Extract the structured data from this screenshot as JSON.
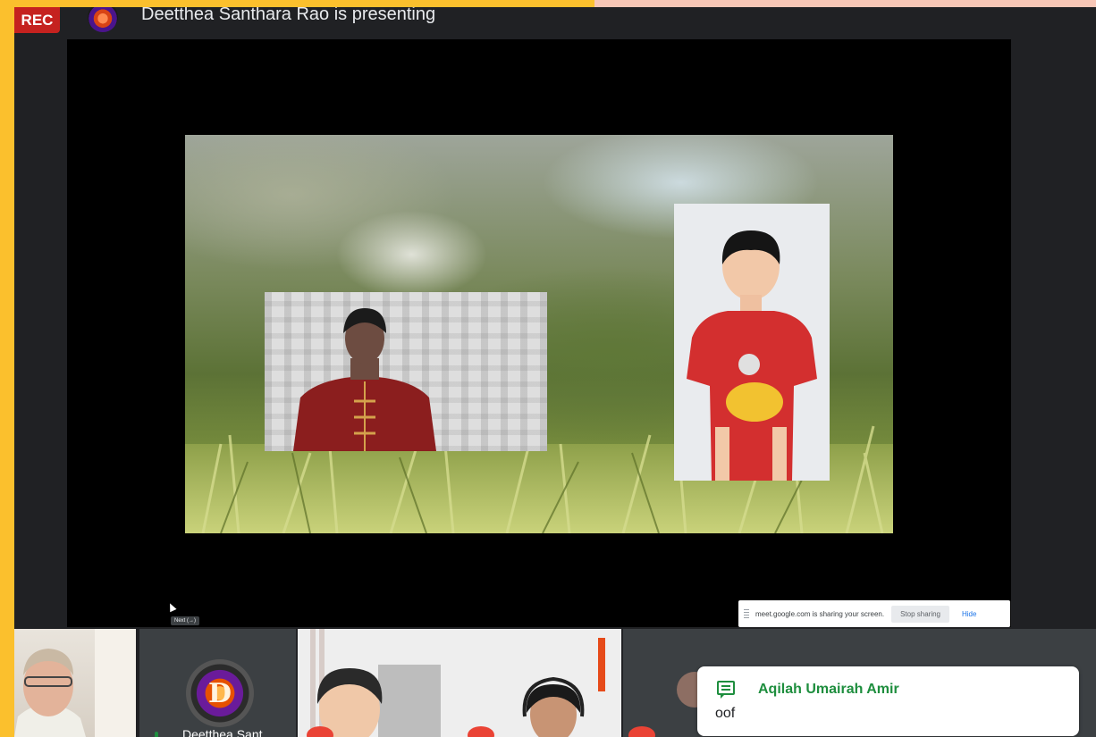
{
  "recording_badge": "REC",
  "presenter": {
    "text": "Deetthea Santhara Rao is presenting",
    "avatar_letter": "D"
  },
  "screen_share": {
    "bar_message": "meet.google.com is sharing your screen.",
    "stop_label": "Stop sharing",
    "hide_label": "Hide",
    "cursor_tooltip": "Next (→)"
  },
  "participants": [
    {
      "id": "tile1",
      "type": "video"
    },
    {
      "id": "tile2",
      "type": "avatar",
      "avatar_letter": "D",
      "name_fragment": "Deetthea Sant"
    },
    {
      "id": "tile3",
      "type": "video"
    },
    {
      "id": "tile4",
      "type": "avatar"
    }
  ],
  "chat_toast": {
    "sender": "Aqilah Umairah Amir",
    "message": "oof",
    "icon": "chat-icon"
  },
  "colors": {
    "frame": "#fbc02d",
    "rec": "#c5221f",
    "chat_green": "#1e8e3e",
    "mic_off": "#ea4335"
  }
}
